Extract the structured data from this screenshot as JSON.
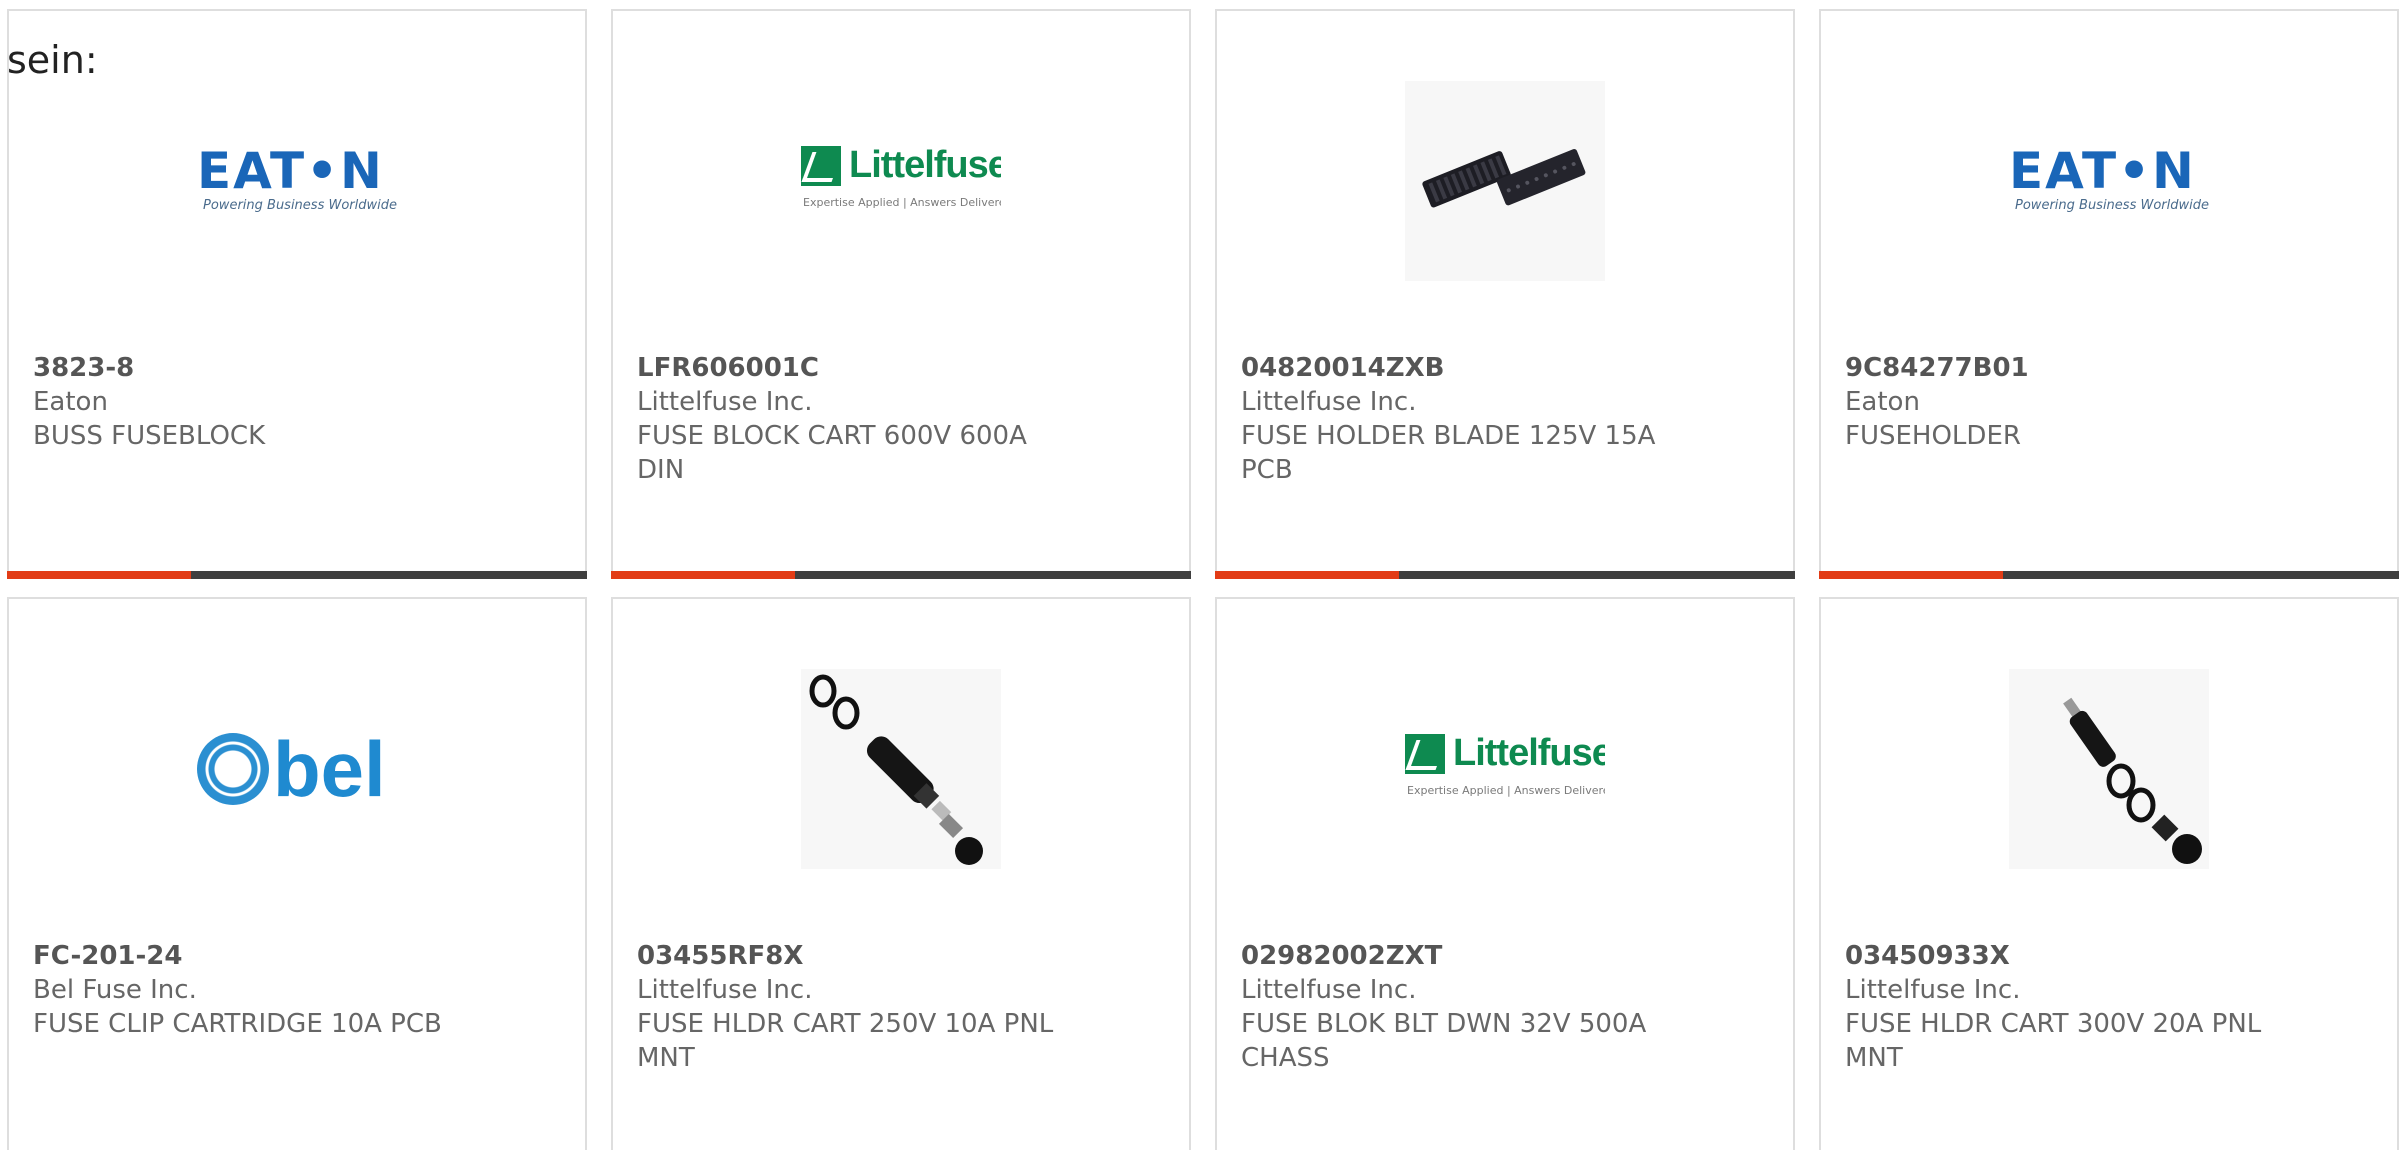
{
  "intro_text": "sein:",
  "colors": {
    "accent": "#e23c16",
    "bar_dark": "#3f3f3f",
    "text": "#666666",
    "border": "#dedede"
  },
  "products": [
    {
      "part_number": "3823-8",
      "manufacturer": "Eaton",
      "description": "BUSS FUSEBLOCK",
      "image": "eaton-logo"
    },
    {
      "part_number": "LFR606001C",
      "manufacturer": "Littelfuse Inc.",
      "description": "FUSE BLOCK CART 600V 600A DIN",
      "image": "littelfuse-logo"
    },
    {
      "part_number": "04820014ZXB",
      "manufacturer": "Littelfuse Inc.",
      "description": "FUSE HOLDER BLADE 125V 15A PCB",
      "image": "fuse-holder-blade-photo"
    },
    {
      "part_number": "9C84277B01",
      "manufacturer": "Eaton",
      "description": "FUSEHOLDER",
      "image": "eaton-logo"
    },
    {
      "part_number": "FC-201-24",
      "manufacturer": "Bel Fuse Inc.",
      "description": "FUSE CLIP CARTRIDGE 10A PCB",
      "image": "bel-logo"
    },
    {
      "part_number": "03455RF8X",
      "manufacturer": "Littelfuse Inc.",
      "description": "FUSE HLDR CART 250V 10A PNL MNT",
      "image": "panel-fuse-holder-photo"
    },
    {
      "part_number": "02982002ZXT",
      "manufacturer": "Littelfuse Inc.",
      "description": "FUSE BLOK BLT DWN 32V 500A CHASS",
      "image": "littelfuse-logo"
    },
    {
      "part_number": "03450933X",
      "manufacturer": "Littelfuse Inc.",
      "description": "FUSE HLDR CART 300V 20A PNL MNT",
      "image": "panel-fuse-holder-photo"
    }
  ],
  "logos": {
    "eaton": {
      "word": "EAT•N",
      "tagline": "Powering Business Worldwide"
    },
    "littelfuse": {
      "word": "Littelfuse",
      "tagline": "Expertise Applied | Answers Delivered"
    },
    "bel": {
      "word": "bel"
    }
  }
}
